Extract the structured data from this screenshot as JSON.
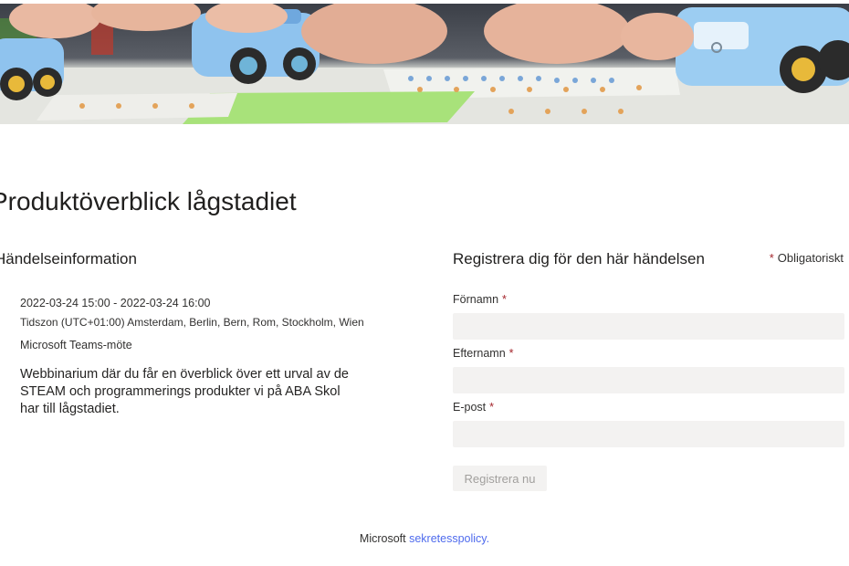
{
  "event": {
    "title": "Produktöverblick lågstadiet",
    "info_heading": "Händelseinformation",
    "datetime": "2022-03-24 15:00 - 2022-03-24 16:00",
    "timezone": "Tidszon (UTC+01:00) Amsterdam, Berlin, Bern, Rom, Stockholm, Wien",
    "location": "Microsoft Teams-möte",
    "description": "Webbinarium där du får en överblick över ett urval av de STEAM och programmerings produkter vi på ABA Skol har till lågstadiet."
  },
  "registration": {
    "heading": "Registrera dig för den här händelsen",
    "required_marker": "*",
    "required_label": "Obligatoriskt",
    "fields": [
      {
        "label": "Förnamn",
        "value": "",
        "required": true
      },
      {
        "label": "Efternamn",
        "value": "",
        "required": true
      },
      {
        "label": "E-post",
        "value": "",
        "required": true
      }
    ],
    "submit_label": "Registrera nu"
  },
  "footer": {
    "prefix": "Microsoft",
    "link_label": "sekretesspolicy."
  },
  "colors": {
    "required": "#a4262c",
    "link": "#4f6bed",
    "field_bg": "#f3f2f1",
    "robot_blue": "#8fc3ee"
  },
  "icons": [
    "banner-photo"
  ]
}
